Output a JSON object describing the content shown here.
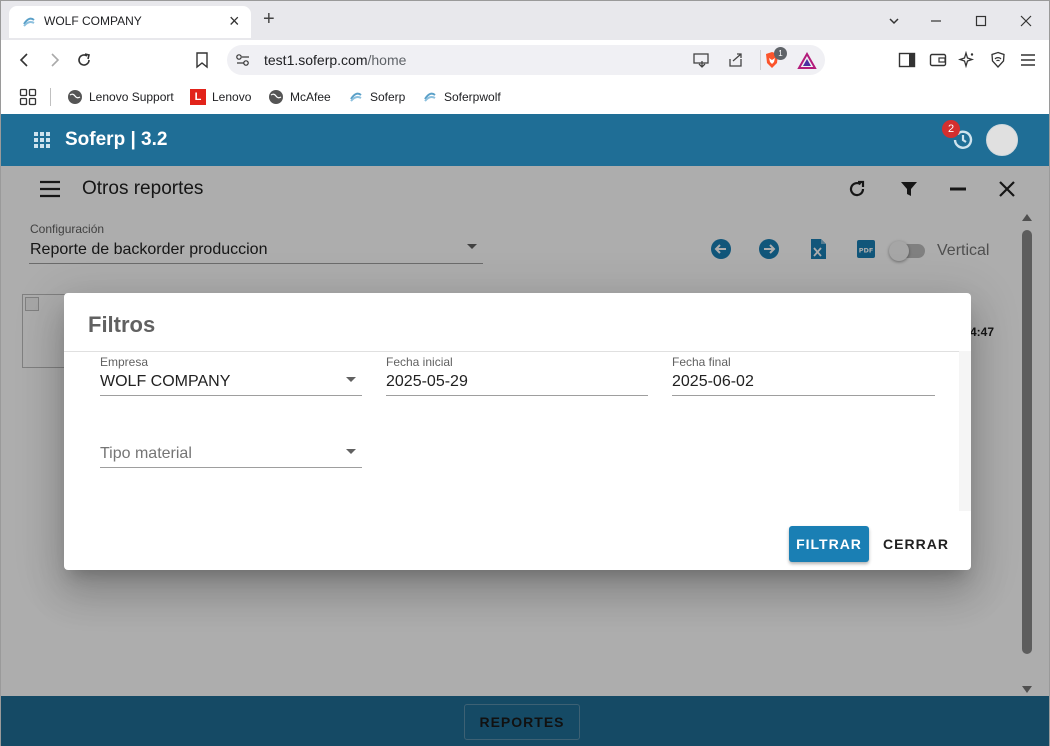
{
  "browser": {
    "tab_title": "WOLF COMPANY",
    "url_host": "test1.soferp.com",
    "url_path": "/home",
    "brave_badge": "1",
    "bookmarks": [
      {
        "label": "Lenovo Support",
        "icon": "globe-icon"
      },
      {
        "label": "Lenovo",
        "icon": "lenovo-logo-icon"
      },
      {
        "label": "McAfee",
        "icon": "globe-icon"
      },
      {
        "label": "Soferp",
        "icon": "soferp-logo-icon"
      },
      {
        "label": "Soferpwolf",
        "icon": "soferp-logo-icon"
      }
    ]
  },
  "app": {
    "title": "Soferp | 3.2",
    "notification_count": "2",
    "brand_color": "#1f6e96"
  },
  "page": {
    "title": "Otros reportes",
    "config_label": "Configuración",
    "config_value": "Reporte de backorder produccion",
    "orientation_label": "Vertical",
    "time_fragment": "4:47"
  },
  "dialog": {
    "title": "Filtros",
    "fields": {
      "empresa": {
        "label": "Empresa",
        "value": "WOLF COMPANY"
      },
      "fecha_inicial": {
        "label": "Fecha inicial",
        "value": "2025-05-29"
      },
      "fecha_final": {
        "label": "Fecha final",
        "value": "2025-06-02"
      },
      "tipo_material": {
        "placeholder": "Tipo material"
      }
    },
    "filter_button": "FILTRAR",
    "close_button": "CERRAR",
    "accent_color": "#1a7fb4"
  },
  "footer": {
    "reports_button": "REPORTES"
  }
}
